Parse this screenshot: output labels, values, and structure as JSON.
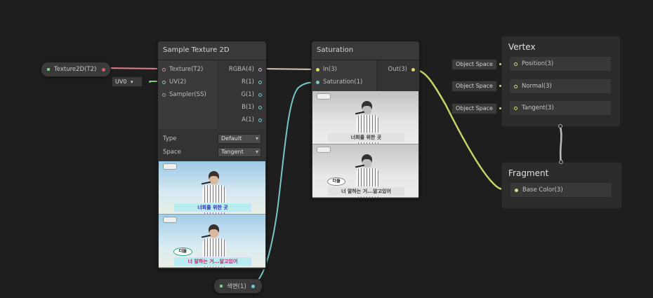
{
  "colors": {
    "background": "#1e1e1e",
    "texture_wire": "#e67d91",
    "vector4_wire": "#d9d96c",
    "float_wire": "#76c6c6",
    "uv_wire": "#7fcf7f"
  },
  "texture_property": {
    "label": "Texture2D(T2)"
  },
  "uv_field": {
    "label": "UV0"
  },
  "float_property": {
    "label": "색변(1)"
  },
  "sample_texture": {
    "title": "Sample Texture 2D",
    "inputs": [
      "Texture(T2)",
      "UV(2)",
      "Sampler(SS)"
    ],
    "outputs": [
      "RGBA(4)",
      "R(1)",
      "G(1)",
      "B(1)",
      "A(1)"
    ],
    "settings": {
      "type_label": "Type",
      "type_value": "Default",
      "space_label": "Space",
      "space_value": "Tangent"
    },
    "preview": {
      "caption_top": "너희를 위한 곳",
      "bubble": "더들",
      "caption_bottom": "너 말하는 거...알고있어"
    }
  },
  "saturation": {
    "title": "Saturation",
    "inputs": [
      "In(3)",
      "Saturation(1)"
    ],
    "output": "Out(3)",
    "preview": {
      "caption_top": "너희를 위한 곳",
      "bubble": "더들",
      "caption_bottom": "너 말하는 거...알고있어"
    }
  },
  "vertex": {
    "title": "Vertex",
    "blocks": [
      "Position(3)",
      "Normal(3)",
      "Tangent(3)"
    ],
    "space_labels": [
      "Object Space",
      "Object Space",
      "Object Space"
    ]
  },
  "fragment": {
    "title": "Fragment",
    "blocks": [
      "Base Color(3)"
    ]
  }
}
